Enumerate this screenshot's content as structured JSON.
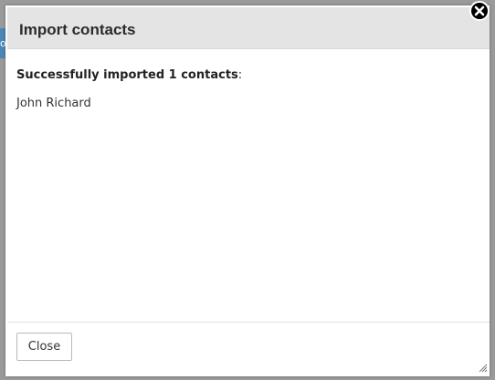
{
  "background": {
    "tab_fragment": "o"
  },
  "dialog": {
    "title": "Import contacts",
    "success_prefix": "Successfully imported 1 contacts",
    "success_suffix": ":",
    "contacts": [
      "John Richard"
    ],
    "close_label": "Close",
    "close_icon": "close-x-icon",
    "resize_icon": "resize-grip-icon"
  }
}
